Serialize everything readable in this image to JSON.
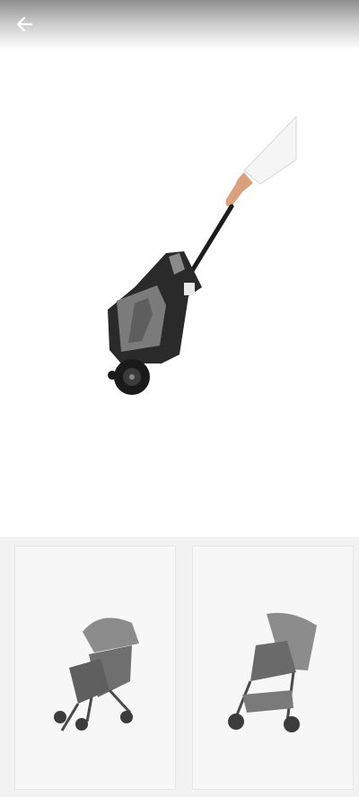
{
  "header": {
    "back_icon": "arrow-left-icon"
  },
  "gallery": {
    "main_image": "folded-stroller-pulled-by-hand",
    "thumbnails": [
      {
        "image": "stroller-front-angle"
      },
      {
        "image": "stroller-side-angle"
      }
    ]
  },
  "colors": {
    "header_gradient_top": "#8d8d8d",
    "background": "#ffffff",
    "thumbnail_strip": "#f2f2f2"
  }
}
